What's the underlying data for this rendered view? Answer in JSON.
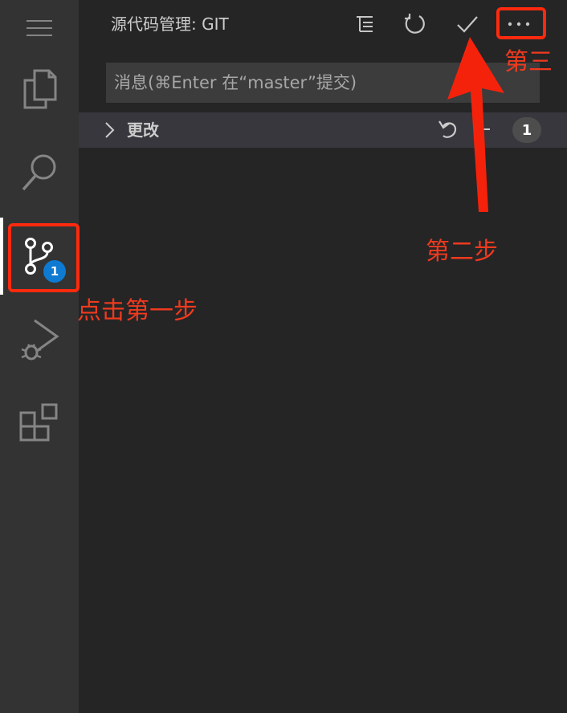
{
  "panel": {
    "title": "源代码管理: GIT",
    "commit_placeholder": "消息(⌘Enter 在“master”提交)"
  },
  "toolbar": {
    "icons": [
      "view-as-tree-icon",
      "refresh-icon",
      "commit-check-icon",
      "more-actions-icon"
    ]
  },
  "activity_bar": {
    "icons": [
      "menu-icon",
      "explorer-files-icon",
      "search-icon",
      "source-control-icon",
      "run-debug-icon",
      "extensions-icon"
    ],
    "source_control_badge": "1"
  },
  "changes": {
    "label": "更改",
    "count": "1"
  },
  "annotations": {
    "step1": "点击第一步",
    "step2": "第二步",
    "step3": "第三"
  },
  "colors": {
    "annotation_red": "#f03a1e",
    "badge_blue": "#0e7ad1",
    "activity_bar_bg": "#333333",
    "sidebar_bg": "#252526"
  }
}
